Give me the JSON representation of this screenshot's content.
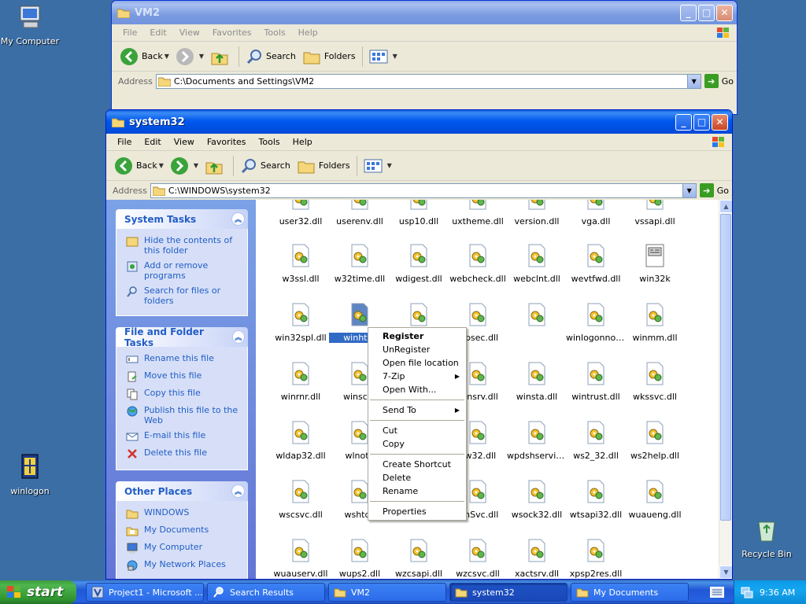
{
  "desktop": {
    "icons": [
      {
        "label": "My Computer"
      },
      {
        "label": "winlogon"
      },
      {
        "label": "Recycle Bin"
      }
    ]
  },
  "back_window": {
    "title": "VM2",
    "menu": [
      "File",
      "Edit",
      "View",
      "Favorites",
      "Tools",
      "Help"
    ],
    "toolbar": {
      "back": "Back",
      "search": "Search",
      "folders": "Folders"
    },
    "address_label": "Address",
    "address": "C:\\Documents and Settings\\VM2",
    "go": "Go"
  },
  "window": {
    "title": "system32",
    "menu": [
      "File",
      "Edit",
      "View",
      "Favorites",
      "Tools",
      "Help"
    ],
    "toolbar": {
      "back": "Back",
      "search": "Search",
      "folders": "Folders"
    },
    "address_label": "Address",
    "address": "C:\\WINDOWS\\system32",
    "go": "Go"
  },
  "taskpane": {
    "system_tasks": {
      "title": "System Tasks",
      "items": [
        "Hide the contents of this folder",
        "Add or remove programs",
        "Search for files or folders"
      ]
    },
    "file_tasks": {
      "title": "File and Folder Tasks",
      "items": [
        "Rename this file",
        "Move this file",
        "Copy this file",
        "Publish this file to the Web",
        "E-mail this file",
        "Delete this file"
      ]
    },
    "other_places": {
      "title": "Other Places",
      "items": [
        "WINDOWS",
        "My Documents",
        "My Computer",
        "My Network Places"
      ]
    }
  },
  "files": [
    {
      "name": "user32.dll"
    },
    {
      "name": "userenv.dll"
    },
    {
      "name": "usp10.dll"
    },
    {
      "name": "uxtheme.dll"
    },
    {
      "name": "version.dll"
    },
    {
      "name": "vga.dll"
    },
    {
      "name": "vssapi.dll"
    },
    {
      "name": "w3ssl.dll"
    },
    {
      "name": "w32time.dll"
    },
    {
      "name": "wdigest.dll"
    },
    {
      "name": "webcheck.dll"
    },
    {
      "name": "webclnt.dll"
    },
    {
      "name": "wevtfwd.dll"
    },
    {
      "name": "win32k"
    },
    {
      "name": "win32spl.dll"
    },
    {
      "name": "winhttp"
    },
    {
      "name": ""
    },
    {
      "name": "nipsec.dll"
    },
    {
      "name": ""
    },
    {
      "name": "winlogonnot..."
    },
    {
      "name": "winmm.dll"
    },
    {
      "name": "winrnr.dll"
    },
    {
      "name": "winscar"
    },
    {
      "name": ""
    },
    {
      "name": "winsrv.dll"
    },
    {
      "name": "winsta.dll"
    },
    {
      "name": "wintrust.dll"
    },
    {
      "name": "wkssvc.dll"
    },
    {
      "name": "wldap32.dll"
    },
    {
      "name": "wlnotif"
    },
    {
      "name": ""
    },
    {
      "name": "ow32.dll"
    },
    {
      "name": "wpdshservic..."
    },
    {
      "name": "ws2_32.dll"
    },
    {
      "name": "ws2help.dll"
    },
    {
      "name": "wscsvc.dll"
    },
    {
      "name": "wshtcp"
    },
    {
      "name": ""
    },
    {
      "name": "smSvc.dll"
    },
    {
      "name": "wsock32.dll"
    },
    {
      "name": "wtsapi32.dll"
    },
    {
      "name": "wuaueng.dll"
    },
    {
      "name": "wuauserv.dll"
    },
    {
      "name": "wups2.dll"
    },
    {
      "name": "wzcsapi.dll"
    },
    {
      "name": "wzcsvc.dll"
    },
    {
      "name": "xactsrv.dll"
    },
    {
      "name": "xpsp2res.dll"
    }
  ],
  "context_menu": [
    {
      "label": "Register",
      "bold": true
    },
    {
      "label": "UnRegister"
    },
    {
      "label": "Open file location"
    },
    {
      "label": "7-Zip",
      "submenu": true
    },
    {
      "label": "Open With..."
    },
    {
      "sep": true
    },
    {
      "label": "Send To",
      "submenu": true
    },
    {
      "sep": true
    },
    {
      "label": "Cut"
    },
    {
      "label": "Copy"
    },
    {
      "sep": true
    },
    {
      "label": "Create Shortcut"
    },
    {
      "label": "Delete"
    },
    {
      "label": "Rename"
    },
    {
      "sep": true
    },
    {
      "label": "Properties"
    }
  ],
  "taskbar": {
    "start": "start",
    "buttons": [
      "Project1 - Microsoft ...",
      "Search Results",
      "VM2",
      "system32",
      "My Documents"
    ],
    "active_button": "system32",
    "clock": "9:36 AM"
  },
  "colors": {
    "desktop": "#3a6ea5",
    "titlebar": "#0058ee",
    "taskpane_link": "#215dc6",
    "selection": "#316ac5"
  }
}
